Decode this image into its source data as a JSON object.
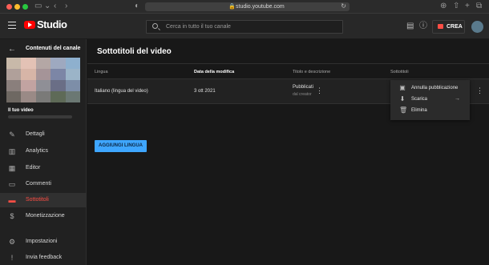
{
  "browser": {
    "url": "studio.youtube.com"
  },
  "header": {
    "logo_text": "Studio",
    "search_placeholder": "Cerca in tutto il tuo canale",
    "create_label": "CREA"
  },
  "sidebar": {
    "back_title": "Contenuti del canale",
    "channel_label": "Il tuo video",
    "items": [
      {
        "label": "Dettagli",
        "icon": "pencil-icon"
      },
      {
        "label": "Analytics",
        "icon": "analytics-icon"
      },
      {
        "label": "Editor",
        "icon": "editor-icon"
      },
      {
        "label": "Commenti",
        "icon": "comment-icon"
      },
      {
        "label": "Sottotitoli",
        "icon": "subtitles-icon",
        "active": true
      },
      {
        "label": "Monetizzazione",
        "icon": "dollar-icon"
      },
      {
        "label": "Impostazioni",
        "icon": "gear-icon"
      },
      {
        "label": "Invia feedback",
        "icon": "feedback-icon"
      }
    ]
  },
  "main": {
    "title": "Sottotitoli del video",
    "columns": [
      "Lingua",
      "Data della modifica",
      "Titolo e descrizione",
      "Sottotitoli"
    ],
    "row": {
      "language": "Italiano (lingua del video)",
      "date": "3 ott 2021",
      "title_status": "Pubblicati",
      "title_sub": "dal creator"
    },
    "add_button": "AGGIUNGI LINGUA"
  },
  "menu": {
    "items": [
      {
        "label": "Annulla pubblicazione",
        "icon": "unpublish-icon"
      },
      {
        "label": "Scarica",
        "icon": "download-icon",
        "arrow": "→"
      },
      {
        "label": "Elimina",
        "icon": "trash-icon"
      }
    ]
  },
  "colors": {
    "accent_red": "#ff4e45",
    "button_blue": "#3ea6ff",
    "background": "#181818"
  }
}
